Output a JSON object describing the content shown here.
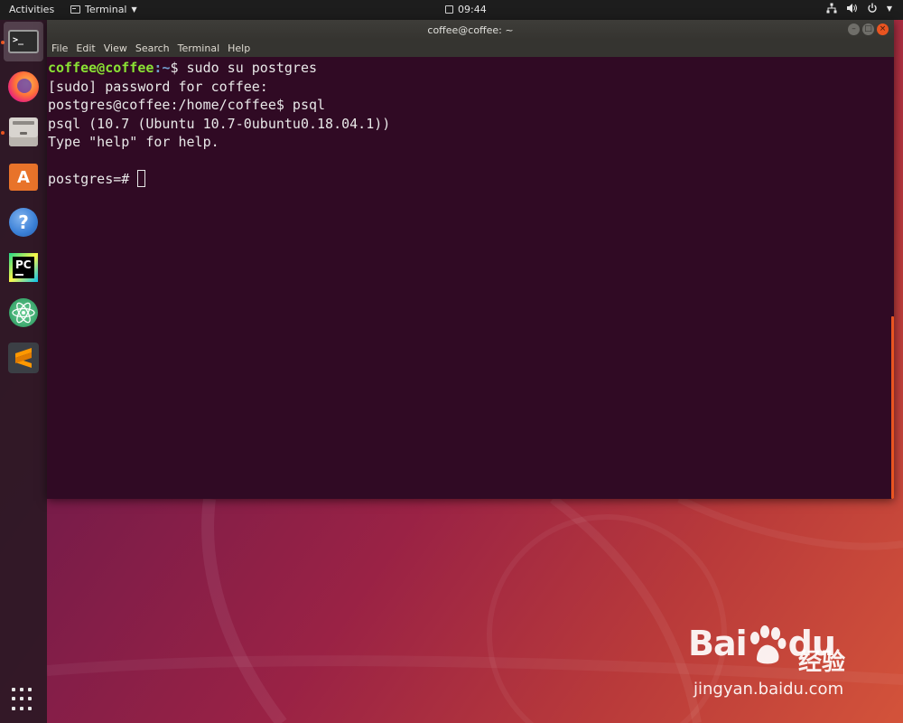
{
  "top_bar": {
    "activities_label": "Activities",
    "app_menu_label": "Terminal",
    "clock": "09:44",
    "tray_icons": [
      "network-icon",
      "volume-icon",
      "power-icon"
    ]
  },
  "dock": {
    "items": [
      {
        "name": "terminal",
        "active": true
      },
      {
        "name": "firefox",
        "active": false
      },
      {
        "name": "files",
        "active": false
      },
      {
        "name": "ubuntu-software",
        "active": false
      },
      {
        "name": "help",
        "active": false
      },
      {
        "name": "pycharm",
        "active": false
      },
      {
        "name": "atom",
        "active": false
      },
      {
        "name": "sublime-text",
        "active": false
      },
      {
        "name": "show-applications",
        "active": false
      }
    ],
    "software_glyph": "A",
    "help_glyph": "?",
    "pycharm_glyph": "PC",
    "terminal_glyph": ">_"
  },
  "window": {
    "title": "coffee@coffee: ~",
    "menu": [
      "File",
      "Edit",
      "View",
      "Search",
      "Terminal",
      "Help"
    ]
  },
  "terminal": {
    "line1": {
      "user_host": "coffee@coffee",
      "path": ":~",
      "rest": "$ sudo su postgres"
    },
    "line2": "[sudo] password for coffee:",
    "line3": "postgres@coffee:/home/coffee$ psql",
    "line4": "psql (10.7 (Ubuntu 10.7-0ubuntu0.18.04.1))",
    "line5": "Type \"help\" for help.",
    "line6": "",
    "line7": "postgres=# "
  },
  "watermark": {
    "logo": "Bai",
    "logo_end": "du",
    "chinese": "经验",
    "url": "jingyan.baidu.com"
  },
  "colors": {
    "accent": "#e95420",
    "terminal_bg": "#300a24",
    "prompt_user": "#8ae234",
    "prompt_path": "#729fcf"
  }
}
